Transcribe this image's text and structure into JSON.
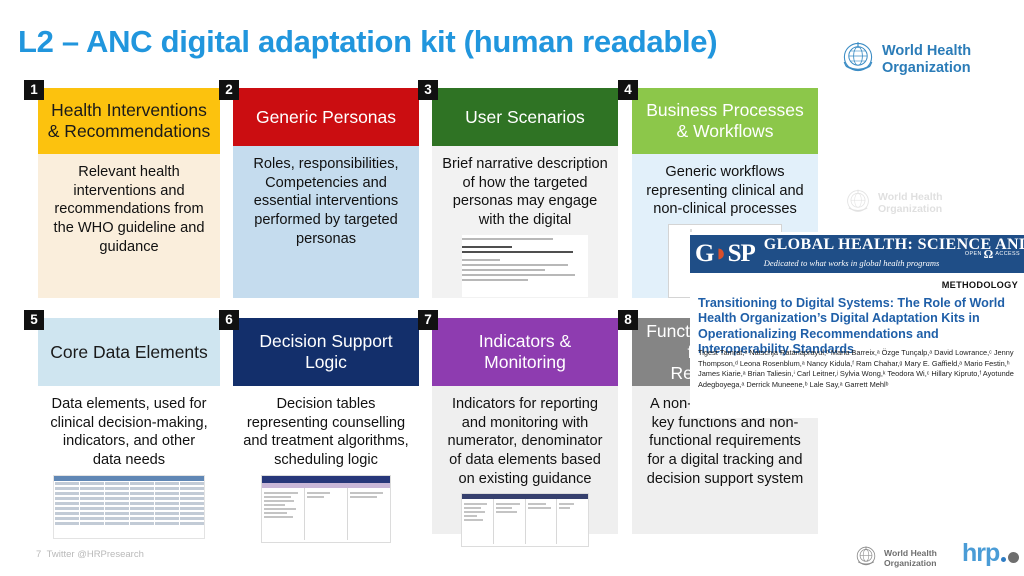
{
  "slide": {
    "title": "L2 – ANC digital adaptation kit (human readable)",
    "title_color": "#2196dd"
  },
  "who_logo": {
    "line1": "World Health",
    "line2": "Organization",
    "color": "#2b7cb8"
  },
  "cards": [
    {
      "number": "1",
      "title": "Health Interventions & Recommendations",
      "body": "Relevant health interventions and recommendations from the WHO guideline and guidance",
      "header_bg": "#fcc20e",
      "header_text_color": "#1a1a1a",
      "body_bg": "#faeedc",
      "thumb": "none"
    },
    {
      "number": "2",
      "title": "Generic Personas",
      "body": "Roles, responsibilities, Competencies and essential interventions performed by targeted personas",
      "header_bg": "#cb0d11",
      "header_text_color": "#ffffff",
      "body_bg": "#c5dcee",
      "thumb": "none"
    },
    {
      "number": "3",
      "title": "User Scenarios",
      "body": "Brief narrative description of how the targeted personas may engage with the digital",
      "header_bg": "#2f7324",
      "header_text_color": "#ffffff",
      "body_bg": "#f2f2f2",
      "thumb": "document-thumbnail"
    },
    {
      "number": "4",
      "title": "Business Processes & Workflows",
      "body": "Generic  workflows representing clinical and non-clinical processes",
      "header_bg": "#8cc74a",
      "header_text_color": "#ffffff",
      "body_bg": "#e2f0fa",
      "thumb": "workflow-thumbnail"
    },
    {
      "number": "5",
      "title": "Core Data Elements",
      "body": "Data elements, used for clinical decision-making, indicators, and other data needs",
      "header_bg": "#cfe5f0",
      "header_text_color": "#1a1a1a",
      "body_bg": "#ffffff",
      "thumb": "spreadsheet-thumbnail"
    },
    {
      "number": "6",
      "title": "Decision Support Logic",
      "body": "Decision tables representing counselling and treatment algorithms, scheduling logic",
      "header_bg": "#132f6b",
      "header_text_color": "#ffffff",
      "body_bg": "#ffffff",
      "thumb": "decision-table-thumbnail"
    },
    {
      "number": "7",
      "title": "Indicators & Monitoring",
      "body": "Indicators for reporting and monitoring with numerator, denominator of data elements based on existing guidance",
      "header_bg": "#8e3cb0",
      "header_text_color": "#ffffff",
      "body_bg": "#efefef",
      "thumb": "indicator-table-thumbnail"
    },
    {
      "number": "8",
      "title": "Functional and Non-functional Requirements",
      "body": "A non-exhaustive list of key functions and non-functional requirements for a digital tracking and decision support system",
      "header_bg": "#858585",
      "header_text_color": "#ffffff",
      "body_bg": "#efefef",
      "thumb": "none"
    }
  ],
  "article_overlay": {
    "journal_mark": "GHSP",
    "journal_name": "GLOBAL HEALTH: SCIENCE AND PRACTICE",
    "journal_tagline": "Dedicated to what works in global health programs",
    "open_access_left": "OPEN",
    "open_access_right": "ACCESS",
    "section_label": "METHODOLOGY",
    "title": "Transitioning to Digital Systems: The Role of World Health Organization’s Digital Adaptation Kits in Operationalizing Recommendations and Interoperability Standards",
    "authors": "Tigest Tamrat,ᵃ Natschja Ratanaprayul,ᵇ Maria Barreix,ᵃ Özge Tunçalp,ᵃ David Lowrance,ᶜ Jenny Thompson,ᵈ Leona Rosenblum,ᵃ Nancy Kidula,ᶠ Ram Chahar,ᵍ Mary E. Gaffield,ᵃ Mario Festin,ʰ James Kiarie,ᵃ Brian Taliesin,ⁱ Carl Leitner,ʲ Sylvia Wong,ᵏ Teodora Wi,ᶜ Hillary Kipruto,ᶠ Ayotunde Adegboyega,ᵃ Derrick Muneene,ᵇ Lale Say,ᵃ Garrett Mehlᵇ"
  },
  "footer": {
    "slide_number": "7",
    "handle": "Twitter @HRPresearch",
    "hrp_word": "hrp"
  }
}
